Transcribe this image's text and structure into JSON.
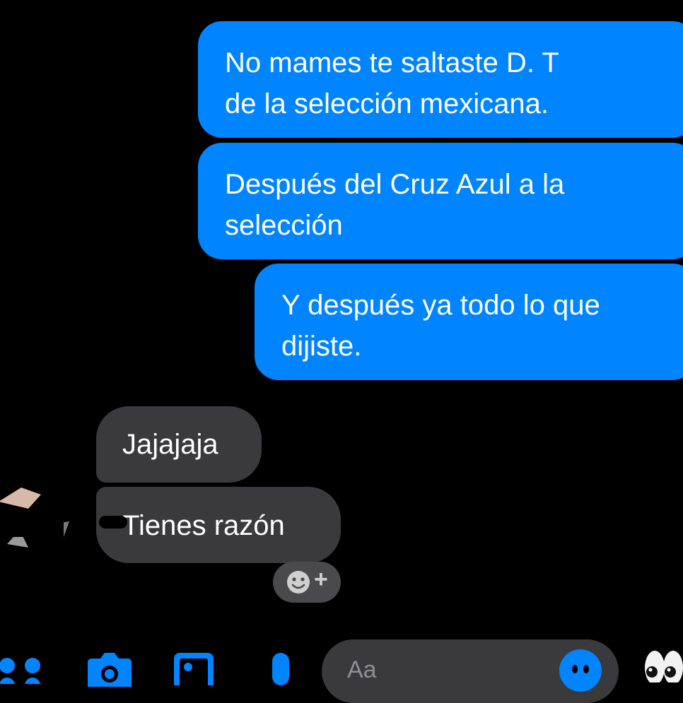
{
  "messages": [
    {
      "id": "m1",
      "direction": "sent",
      "lines": [
        "No mames te saltaste D. T",
        "de la selección mexicana."
      ]
    },
    {
      "id": "m2",
      "direction": "sent",
      "lines": [
        "Después del Cruz Azul a la",
        "selección"
      ]
    },
    {
      "id": "m3",
      "direction": "sent",
      "lines": [
        "Y después ya todo lo que",
        "dijiste."
      ]
    },
    {
      "id": "m4",
      "direction": "received",
      "lines": [
        "Jajajaja"
      ]
    },
    {
      "id": "m5",
      "direction": "received",
      "lines": [
        "Tienes razón"
      ]
    }
  ],
  "reaction_button": {
    "icon": "add-reaction-icon",
    "label": "+"
  },
  "composer": {
    "placeholder": "Aa"
  },
  "bottom_bar": {
    "icons": [
      "menu-dots-icon",
      "camera-icon",
      "gallery-icon",
      "microphone-icon",
      "emoji-icon",
      "eyes-emoji-icon"
    ]
  },
  "colors": {
    "sent_bubble": "#0084ff",
    "received_bubble": "#3a3a3c",
    "background": "#000000",
    "accent": "#0084ff"
  }
}
